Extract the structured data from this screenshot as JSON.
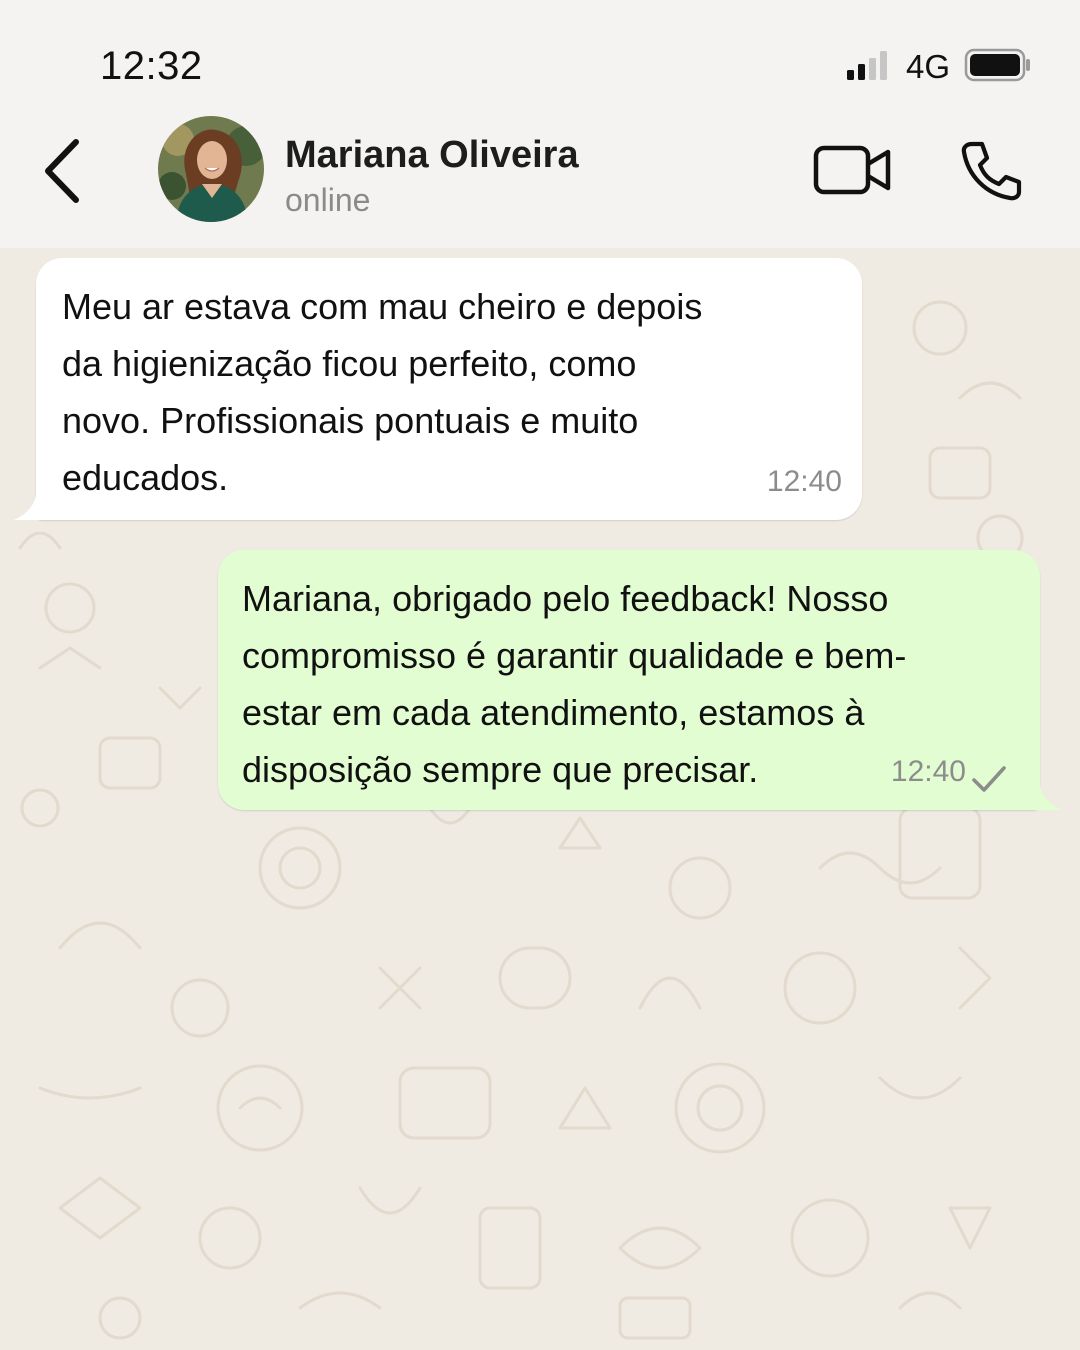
{
  "status_bar": {
    "time": "12:32",
    "network": "4G",
    "signal_icon": "signal-bars-icon",
    "battery_icon": "battery-icon"
  },
  "header": {
    "back_icon": "chevron-left-icon",
    "contact_name": "Mariana Oliveira",
    "contact_status": "online",
    "video_icon": "video-camera-icon",
    "phone_icon": "phone-icon"
  },
  "messages": [
    {
      "direction": "incoming",
      "text": "Meu ar estava com mau cheiro e depois\nda higienização ficou perfeito, como\nnovo. Profissionais pontuais e muito\neducados.",
      "time": "12:40"
    },
    {
      "direction": "outgoing",
      "text": "Mariana, obrigado pelo feedback! Nosso\ncompromisso é garantir qualidade e bem-\nestar em cada atendimento, estamos à\ndisposição sempre que precisar.",
      "time": "12:40",
      "status_icon": "single-check-icon"
    }
  ],
  "colors": {
    "header_bg": "#f4f3f1",
    "chat_bg": "#efeae2",
    "incoming_bubble": "#ffffff",
    "outgoing_bubble": "#e3fdd2",
    "doodle_stroke": "#e2dccf"
  }
}
